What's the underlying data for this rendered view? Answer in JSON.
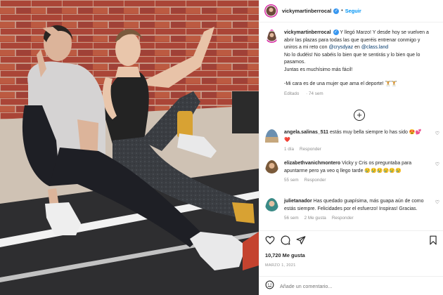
{
  "post": {
    "username": "vickymartinberrocal",
    "follow_label": "Seguir",
    "dot": "•",
    "verified_glyph": "✓"
  },
  "caption": {
    "lines": [
      "Y llegó Marzo! Y desde hoy se vuelven a",
      "abrir las plazas para todas las que queréis entrenar conmigo y",
      "uniros a mi reto con",
      "@crysdyaz",
      "en",
      "@class.land",
      "No lo dudéis! No sabéis lo bien que te sentirás y lo bien que lo",
      "pasamos.",
      "Juntas es muchísimo más fácil!",
      "-Mi cara es de una mujer que ama el deporte! 🏋️🏋️"
    ],
    "edited": "Editado",
    "age": "74 sem"
  },
  "more_comments_icon": "plus-circle-icon",
  "comments": [
    {
      "username": "angela.salinas_511",
      "text": "estás muy bella siempre lo has sido 😍💕❤️",
      "age": "1 día",
      "likes": "",
      "reply": "Responder",
      "avatar_color": "#6b8fb0"
    },
    {
      "username": "elizabethvanichmontero",
      "text": "Vicky y Cris os preguntaba para apuntarme pero ya veo q llego tarde 😢😢😢😢😢😢",
      "age": "55 sem",
      "likes": "",
      "reply": "Responder",
      "avatar_color": "#7a5a3a"
    },
    {
      "username": "julietanador",
      "text": "Has quedado guapísima, más guapa aún de como estás siempre. Felicidades por el esfuerzo! Inspiras! Gracias.",
      "age": "56 sem",
      "likes": "2 Me gusta",
      "reply": "Responder",
      "avatar_color": "#3a8a86"
    }
  ],
  "actions": {
    "icons": [
      "heart-icon",
      "comment-icon",
      "share-icon",
      "bookmark-icon"
    ],
    "likes": "10,720 Me gusta",
    "date": "MARZO 1, 2021"
  },
  "add_comment": {
    "placeholder": "Añade un comentario..."
  },
  "colors": {
    "accent": "#0095f6",
    "verified": "#3897f0",
    "muted": "#8e8e8e",
    "text": "#262626"
  }
}
